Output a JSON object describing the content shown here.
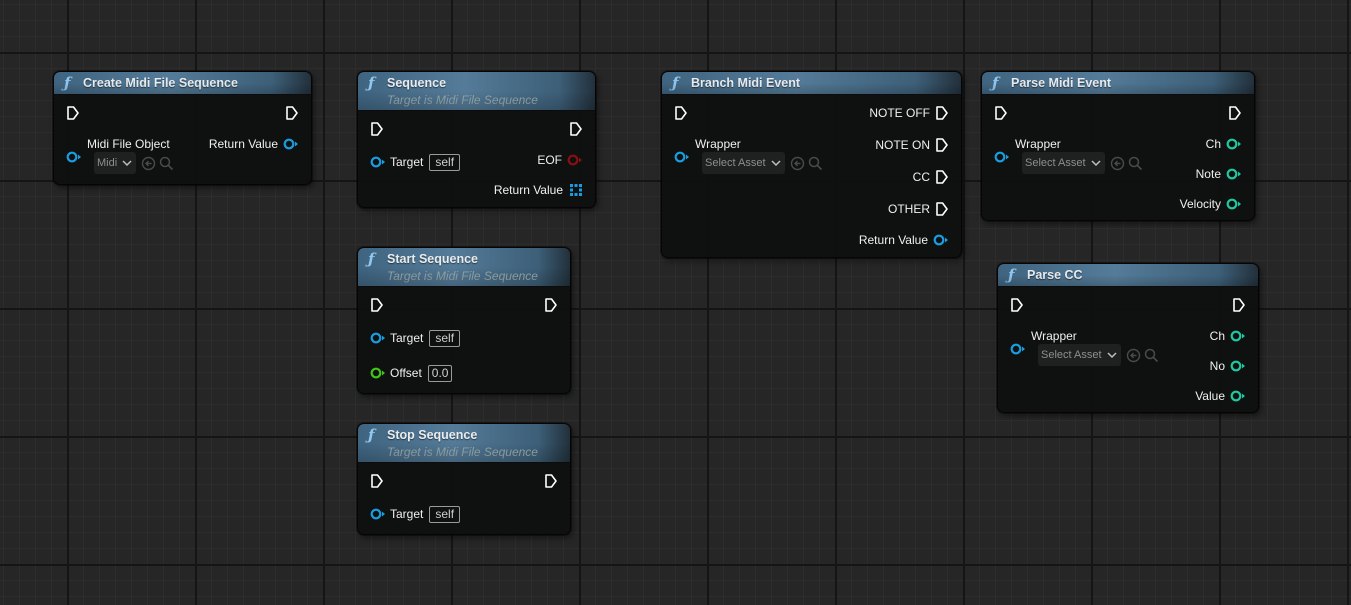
{
  "editor": {
    "type": "blueprint-graph",
    "colors": {
      "header_gradient": "#547b98",
      "function_icon": "#8fc7ef",
      "exec_pin": "#ffffff",
      "object_pin": "#1a9de0",
      "bool_pin": "#8a0f0f",
      "float_pin": "#40c516",
      "byte_pin": "#1ec8a0",
      "array_pin": "#1a9de0"
    }
  },
  "nodes": {
    "create_midi_file_sequence": {
      "icon": "function-icon",
      "glyph": "ƒ",
      "title": "Create Midi File Sequence",
      "inputs": [
        {
          "label": "Midi File Object",
          "type": "object",
          "asset_value": "Midi"
        }
      ],
      "outputs": [
        {
          "label": "Return Value",
          "type": "object"
        }
      ]
    },
    "sequence": {
      "icon": "function-icon",
      "glyph": "ƒ",
      "title": "Sequence",
      "subtitle": "Target is Midi File Sequence",
      "inputs": [
        {
          "label": "Target",
          "type": "object",
          "value": "self"
        }
      ],
      "outputs": [
        {
          "label": "EOF",
          "type": "bool"
        },
        {
          "label": "Return Value",
          "type": "array"
        }
      ]
    },
    "start_sequence": {
      "icon": "function-icon",
      "glyph": "ƒ",
      "title": "Start Sequence",
      "subtitle": "Target is Midi File Sequence",
      "inputs": [
        {
          "label": "Target",
          "type": "object",
          "value": "self"
        },
        {
          "label": "Offset",
          "type": "float",
          "value": "0.0"
        }
      ]
    },
    "stop_sequence": {
      "icon": "function-icon",
      "glyph": "ƒ",
      "title": "Stop Sequence",
      "subtitle": "Target is Midi File Sequence",
      "inputs": [
        {
          "label": "Target",
          "type": "object",
          "value": "self"
        }
      ]
    },
    "branch_midi_event": {
      "icon": "function-icon",
      "glyph": "ƒ",
      "title": "Branch Midi Event",
      "inputs": [
        {
          "label": "Wrapper",
          "type": "object",
          "asset_value": "Select Asset"
        }
      ],
      "exec_outputs": [
        "NOTE OFF",
        "NOTE ON",
        "CC",
        "OTHER"
      ],
      "outputs": [
        {
          "label": "Return Value",
          "type": "object"
        }
      ]
    },
    "parse_midi_event": {
      "icon": "function-icon",
      "glyph": "ƒ",
      "title": "Parse Midi Event",
      "inputs": [
        {
          "label": "Wrapper",
          "type": "object",
          "asset_value": "Select Asset"
        }
      ],
      "outputs": [
        {
          "label": "Ch",
          "type": "byte"
        },
        {
          "label": "Note",
          "type": "byte"
        },
        {
          "label": "Velocity",
          "type": "byte"
        }
      ]
    },
    "parse_cc": {
      "icon": "function-icon",
      "glyph": "ƒ",
      "title": "Parse CC",
      "inputs": [
        {
          "label": "Wrapper",
          "type": "object",
          "asset_value": "Select Asset"
        }
      ],
      "outputs": [
        {
          "label": "Ch",
          "type": "byte"
        },
        {
          "label": "No",
          "type": "byte"
        },
        {
          "label": "Value",
          "type": "byte"
        }
      ]
    }
  }
}
